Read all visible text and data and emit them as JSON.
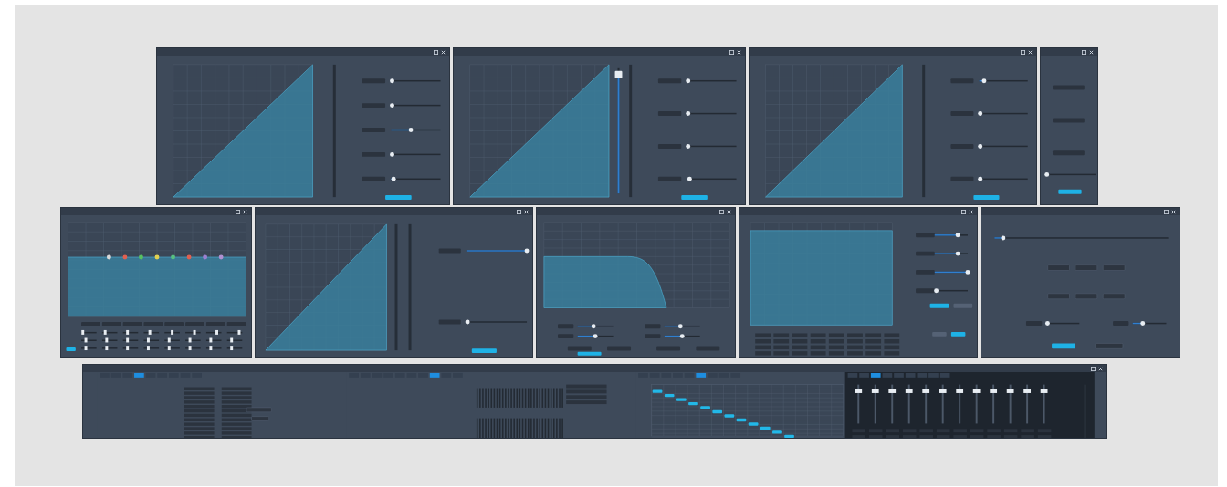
{
  "rows": [
    {
      "panels": [
        {
          "kind": "dynamics",
          "sliders": [
            {
              "level": 0.02
            },
            {
              "level": 0.02
            },
            {
              "level": 0.4
            },
            {
              "level": 0.02
            },
            {
              "level": 0.05
            }
          ]
        },
        {
          "kind": "dynamics",
          "fader": {
            "level": 0.95
          },
          "sliders": [
            {
              "level": 0.02
            },
            {
              "level": 0.02
            },
            {
              "level": 0.02
            },
            {
              "level": 0.05
            }
          ]
        },
        {
          "kind": "dynamics",
          "sliders": [
            {
              "level": 0.1
            },
            {
              "level": 0.02
            },
            {
              "level": 0.02
            },
            {
              "level": 0.02
            }
          ]
        },
        {
          "kind": "delay",
          "sliders": [
            {
              "level": 0.0
            }
          ]
        }
      ]
    },
    {
      "panels": [
        {
          "kind": "eq",
          "bands": [
            {
              "color": "#d8d8d8",
              "sliders": [
                {
                  "level": 0.1
                },
                {
                  "level": 0.3
                },
                {
                  "level": 0.3
                }
              ]
            },
            {
              "color": "#e06050",
              "sliders": [
                {
                  "level": 0.2
                },
                {
                  "level": 0.3
                },
                {
                  "level": 0.3
                }
              ]
            },
            {
              "color": "#58c060",
              "sliders": [
                {
                  "level": 0.3
                },
                {
                  "level": 0.3
                },
                {
                  "level": 0.3
                }
              ]
            },
            {
              "color": "#e0d050",
              "sliders": [
                {
                  "level": 0.4
                },
                {
                  "level": 0.3
                },
                {
                  "level": 0.3
                }
              ]
            },
            {
              "color": "#58c080",
              "sliders": [
                {
                  "level": 0.5
                },
                {
                  "level": 0.3
                },
                {
                  "level": 0.3
                }
              ]
            },
            {
              "color": "#e06050",
              "sliders": [
                {
                  "level": 0.6
                },
                {
                  "level": 0.3
                },
                {
                  "level": 0.3
                }
              ]
            },
            {
              "color": "#9a80d0",
              "sliders": [
                {
                  "level": 0.7
                },
                {
                  "level": 0.3
                },
                {
                  "level": 0.3
                }
              ]
            },
            {
              "color": "#b090d0",
              "sliders": [
                {
                  "level": 0.8
                },
                {
                  "level": 0.3
                },
                {
                  "level": 0.3
                }
              ]
            }
          ]
        },
        {
          "kind": "gain",
          "sliders": [
            {
              "level": 1.0
            },
            {
              "level": 0.02
            }
          ]
        },
        {
          "kind": "filter",
          "sliders": [
            {
              "level": 0.45
            },
            {
              "level": 0.5
            },
            {
              "level": 0.45
            },
            {
              "level": 0.5
            }
          ]
        },
        {
          "kind": "feedback",
          "sliders": [
            {
              "level": 0.7
            },
            {
              "level": 0.7
            },
            {
              "level": 1.0
            },
            {
              "level": 0.05
            }
          ]
        },
        {
          "kind": "automixer",
          "sliders": [
            {
              "level": 0.05
            },
            {
              "level": 0.05
            },
            {
              "level": 0.3
            }
          ]
        }
      ]
    },
    {
      "panels": [
        {
          "kind": "strip",
          "sections": [
            {
              "kind": "router",
              "tabs": [
                {
                  "selected": false
                },
                {
                  "selected": false
                },
                {
                  "selected": false
                },
                {
                  "selected": true
                },
                {
                  "selected": false
                },
                {
                  "selected": false
                },
                {
                  "selected": false
                },
                {
                  "selected": false
                },
                {
                  "selected": false
                }
              ]
            },
            {
              "kind": "graphic-eq",
              "tabs": [
                {
                  "selected": false
                },
                {
                  "selected": false
                },
                {
                  "selected": false
                },
                {
                  "selected": false
                },
                {
                  "selected": false
                },
                {
                  "selected": false
                },
                {
                  "selected": false
                },
                {
                  "selected": true
                },
                {
                  "selected": false
                },
                {
                  "selected": false
                }
              ]
            },
            {
              "kind": "matrix",
              "tabs": [
                {
                  "selected": false
                },
                {
                  "selected": false
                },
                {
                  "selected": false
                },
                {
                  "selected": false
                },
                {
                  "selected": false
                },
                {
                  "selected": true
                },
                {
                  "selected": false
                },
                {
                  "selected": false
                },
                {
                  "selected": false
                }
              ]
            },
            {
              "kind": "mixer",
              "tabs": [
                {
                  "selected": false
                },
                {
                  "selected": false
                },
                {
                  "selected": true
                },
                {
                  "selected": false
                },
                {
                  "selected": false
                },
                {
                  "selected": false
                },
                {
                  "selected": false
                },
                {
                  "selected": false
                },
                {
                  "selected": false
                }
              ],
              "faders": [
                {
                  "level": 0.85
                },
                {
                  "level": 0.85
                },
                {
                  "level": 0.85
                },
                {
                  "level": 0.85
                },
                {
                  "level": 0.85
                },
                {
                  "level": 0.85
                },
                {
                  "level": 0.85
                },
                {
                  "level": 0.85
                },
                {
                  "level": 0.85
                },
                {
                  "level": 0.85
                },
                {
                  "level": 0.85
                },
                {
                  "level": 0.85
                }
              ]
            }
          ]
        }
      ]
    }
  ]
}
